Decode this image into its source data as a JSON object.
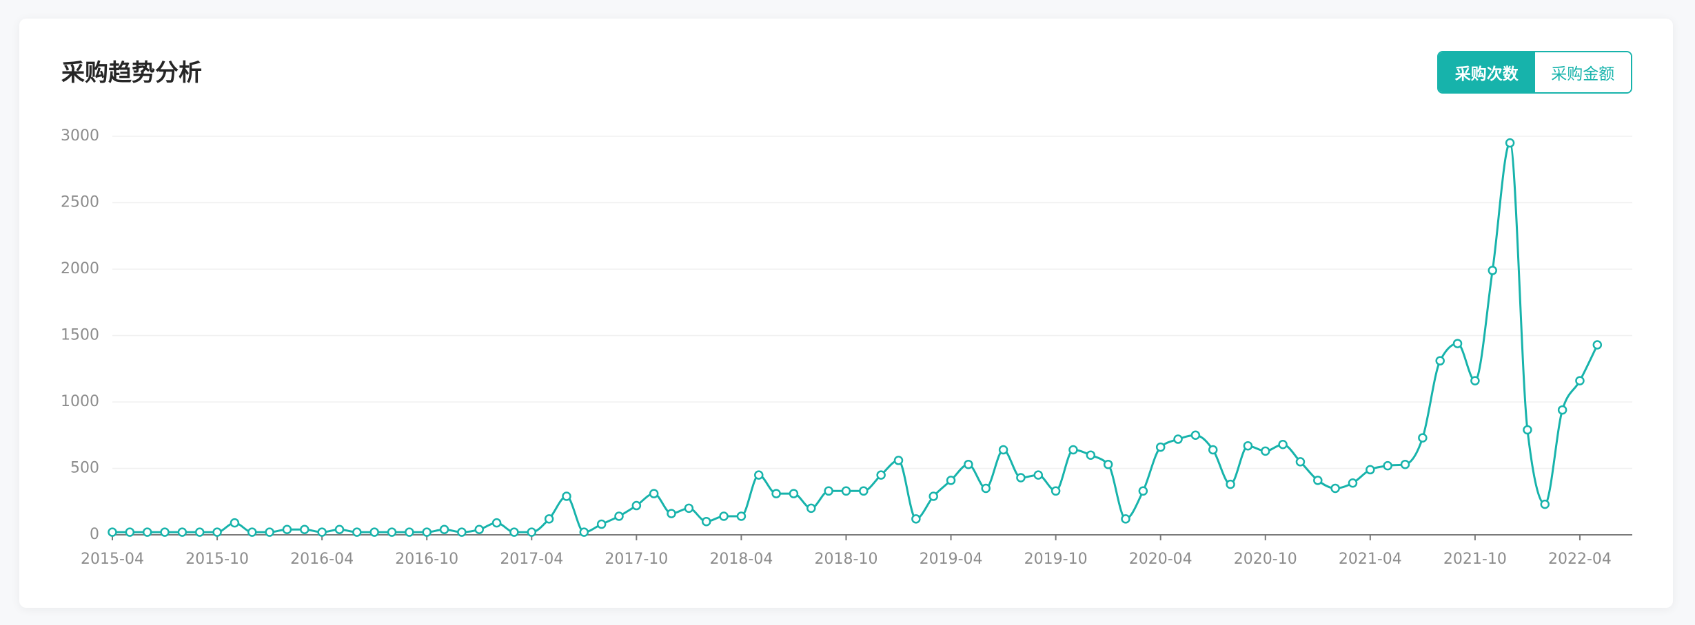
{
  "toggle": {
    "options": [
      {
        "label": "采购次数",
        "active": true
      },
      {
        "label": "采购金额",
        "active": false
      }
    ]
  },
  "colors": {
    "accent": "#17b3ab",
    "title": "#262626",
    "label": "#8c8c8c",
    "grid": "#f0f0f0",
    "axis": "#7a7a7a"
  },
  "chart_data": {
    "type": "line",
    "title": "采购趋势分析",
    "smooth": true,
    "grid": true,
    "x": [
      "2015-04",
      "2015-05",
      "2015-06",
      "2015-07",
      "2015-08",
      "2015-09",
      "2015-10",
      "2015-11",
      "2015-12",
      "2016-01",
      "2016-02",
      "2016-03",
      "2016-04",
      "2016-05",
      "2016-06",
      "2016-07",
      "2016-08",
      "2016-09",
      "2016-10",
      "2016-11",
      "2016-12",
      "2017-01",
      "2017-02",
      "2017-03",
      "2017-04",
      "2017-05",
      "2017-06",
      "2017-07",
      "2017-08",
      "2017-09",
      "2017-10",
      "2017-11",
      "2017-12",
      "2018-01",
      "2018-02",
      "2018-03",
      "2018-04",
      "2018-05",
      "2018-06",
      "2018-07",
      "2018-08",
      "2018-09",
      "2018-10",
      "2018-11",
      "2018-12",
      "2019-01",
      "2019-02",
      "2019-03",
      "2019-04",
      "2019-05",
      "2019-06",
      "2019-07",
      "2019-08",
      "2019-09",
      "2019-10",
      "2019-11",
      "2019-12",
      "2020-01",
      "2020-02",
      "2020-03",
      "2020-04",
      "2020-05",
      "2020-06",
      "2020-07",
      "2020-08",
      "2020-09",
      "2020-10",
      "2020-11",
      "2020-12",
      "2021-01",
      "2021-02",
      "2021-03",
      "2021-04",
      "2021-05",
      "2021-06",
      "2021-07",
      "2021-08",
      "2021-09",
      "2021-10",
      "2021-11",
      "2021-12",
      "2022-01",
      "2022-02",
      "2022-03",
      "2022-04",
      "2022-05"
    ],
    "series": [
      {
        "values": [
          20,
          20,
          20,
          20,
          20,
          20,
          20,
          90,
          20,
          20,
          40,
          40,
          20,
          40,
          20,
          20,
          20,
          20,
          20,
          40,
          20,
          40,
          90,
          20,
          20,
          120,
          290,
          20,
          80,
          140,
          220,
          310,
          160,
          200,
          100,
          140,
          140,
          450,
          310,
          310,
          200,
          330,
          330,
          330,
          450,
          560,
          120,
          290,
          410,
          530,
          350,
          640,
          430,
          450,
          330,
          640,
          600,
          530,
          120,
          330,
          660,
          720,
          750,
          640,
          380,
          670,
          630,
          680,
          550,
          410,
          350,
          390,
          490,
          520,
          530,
          730,
          1310,
          1440,
          1160,
          1990,
          2950,
          790,
          230,
          940,
          1160,
          1430
        ]
      }
    ],
    "xticks": [
      "2015-04",
      "2015-10",
      "2016-04",
      "2016-10",
      "2017-04",
      "2017-10",
      "2018-04",
      "2018-10",
      "2019-04",
      "2019-10",
      "2020-04",
      "2020-10",
      "2021-04",
      "2021-10",
      "2022-04"
    ],
    "yticks": [
      0,
      500,
      1000,
      1500,
      2000,
      2500,
      3000
    ],
    "xlim": [
      "2015-04",
      "2022-07"
    ],
    "ylim": [
      0,
      3000
    ]
  }
}
